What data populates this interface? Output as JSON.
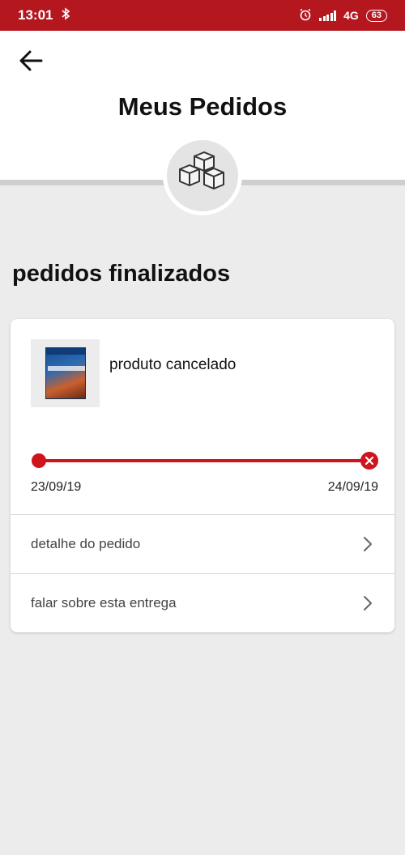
{
  "status_bar": {
    "time": "13:01",
    "network": "4G",
    "battery": "63",
    "icons": [
      "bluetooth-icon",
      "alarm-icon",
      "signal-icon",
      "battery-icon"
    ]
  },
  "header": {
    "title": "Meus Pedidos",
    "back_icon": "back-arrow-icon",
    "badge_icon": "boxes-icon"
  },
  "section": {
    "title": "pedidos finalizados"
  },
  "order": {
    "thumbnail_icon": "product-thumbnail",
    "status": "produto cancelado",
    "timeline": {
      "start_date": "23/09/19",
      "end_date": "24/09/19",
      "end_state_icon": "cancel-x-icon",
      "color": "#d0141e"
    },
    "actions": [
      {
        "label": "detalhe do pedido",
        "icon": "chevron-right-icon"
      },
      {
        "label": "falar sobre esta entrega",
        "icon": "chevron-right-icon"
      }
    ]
  },
  "colors": {
    "status_bar": "#b5171f",
    "accent": "#d0141e",
    "background": "#ececec"
  }
}
